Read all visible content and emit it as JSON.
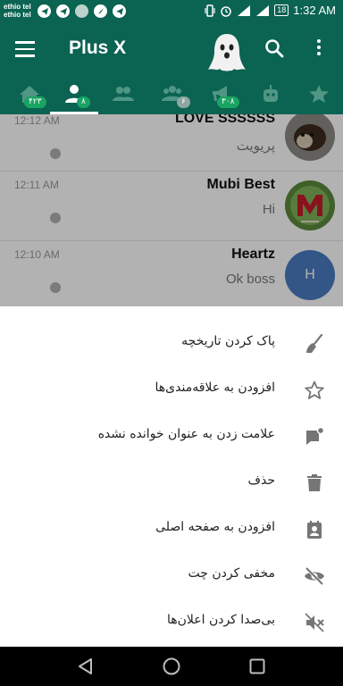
{
  "status_bar": {
    "carrier_1": "ethio tel",
    "carrier_2": "ethio tel",
    "battery": "18",
    "time": "1:32 AM",
    "left_icons": [
      "telegram-icon",
      "telegram-icon",
      "circle-icon",
      "rocket-icon",
      "telegram-icon"
    ],
    "right_icons": [
      "vibrate-icon",
      "alarm-icon",
      "signal-icon",
      "signal-icon"
    ]
  },
  "app_bar": {
    "title": "Plus X",
    "logo": "ghost-icon",
    "background": "#0b6352"
  },
  "tabs": [
    {
      "icon": "home-icon",
      "badge": "۴۲۳",
      "active": false
    },
    {
      "icon": "person-icon",
      "badge": "۸",
      "active": true
    },
    {
      "icon": "group-icon",
      "badge": "",
      "active": false
    },
    {
      "icon": "supergroup-icon",
      "badge": "۶",
      "active": false
    },
    {
      "icon": "channel-icon",
      "badge": "۳۰۸",
      "active": false
    },
    {
      "icon": "bot-icon",
      "badge": "",
      "active": false
    },
    {
      "icon": "star-icon",
      "badge": "",
      "active": false
    }
  ],
  "chats": [
    {
      "time": "12:12 AM",
      "name": "LOVE SSSSSS",
      "message": "پریویت",
      "avatar": "dog-photo"
    },
    {
      "time": "12:11 AM",
      "name": "Mubi Best",
      "message": "Hi",
      "avatar": "m-letter-photo"
    },
    {
      "time": "12:10 AM",
      "name": "Heartz",
      "message": "Ok boss",
      "avatar_letter": "H"
    }
  ],
  "sheet_items": [
    {
      "label": "پاک کردن تاریخچه",
      "icon": "broom-icon"
    },
    {
      "label": "افزودن به علاقه‌مندی‌ها",
      "icon": "star-outline-icon"
    },
    {
      "label": "علامت زدن به عنوان خوانده نشده",
      "icon": "unread-chat-icon"
    },
    {
      "label": "حذف",
      "icon": "trash-icon"
    },
    {
      "label": "افزودن به صفحه اصلی",
      "icon": "contact-card-icon"
    },
    {
      "label": "مخفی کردن چت",
      "icon": "eye-off-icon"
    },
    {
      "label": "بی‌صدا کردن اعلان‌ها",
      "icon": "mute-icon"
    }
  ],
  "nav_bar": [
    "back-icon",
    "home-circle-icon",
    "recents-icon"
  ],
  "colors": {
    "accent": "#0b6352",
    "badge": "#1aa463",
    "avatar_blue": "#4a7bc2"
  }
}
